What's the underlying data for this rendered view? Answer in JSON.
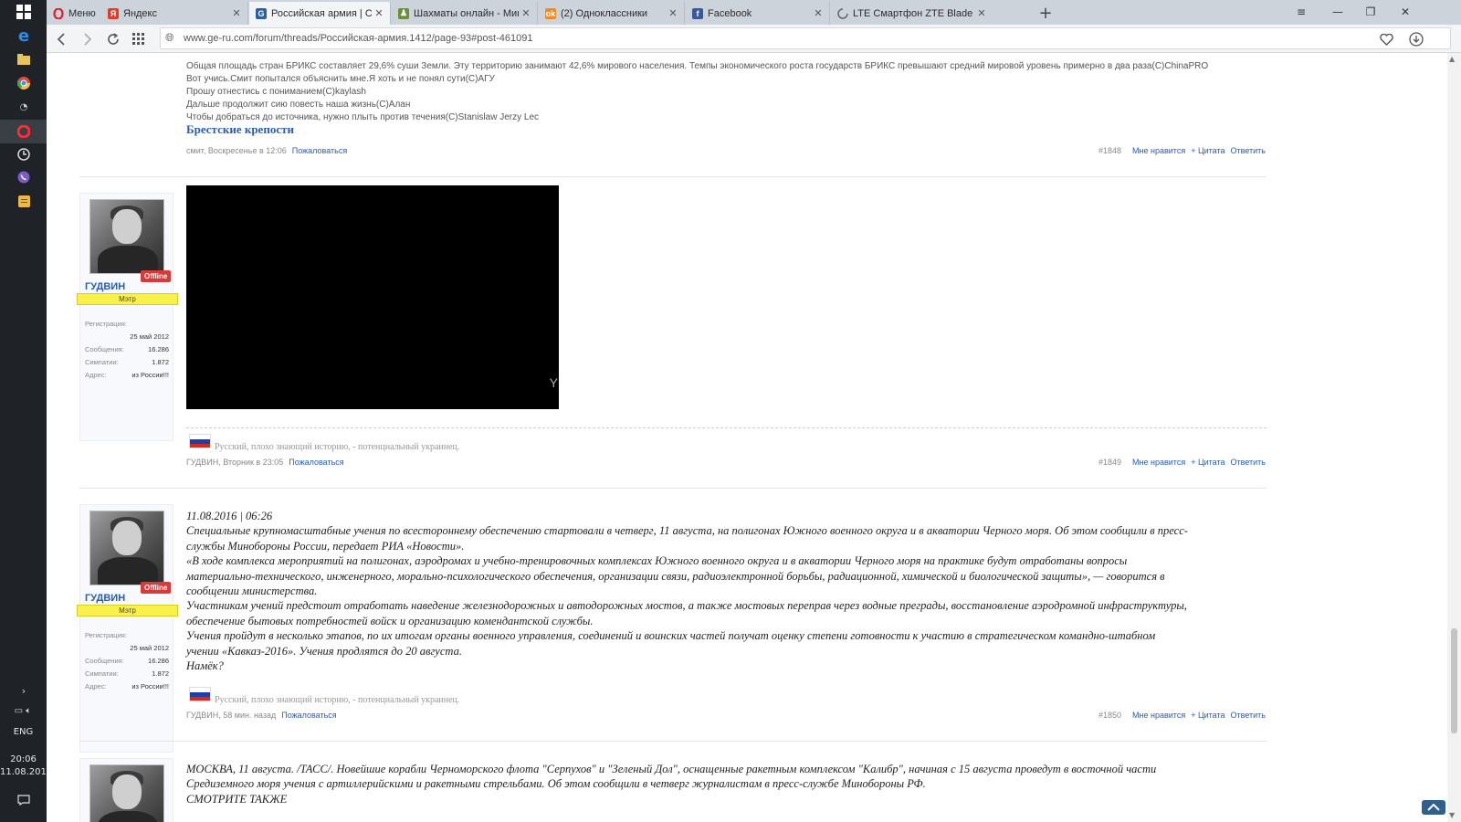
{
  "sidebar": {
    "icons": [
      "windows-start-icon",
      "edge-icon",
      "file-explorer-icon",
      "chrome-icon",
      "network-icon",
      "opera-icon",
      "clock-icon",
      "viber-icon",
      "notes-icon"
    ],
    "tray": {
      "language": "ENG",
      "time": "20:06",
      "date": "11.08.2016"
    }
  },
  "tabs": [
    {
      "label": "Меню"
    },
    {
      "label": "Яндекс"
    },
    {
      "label": "Российская армия | Стра"
    },
    {
      "label": "Шахматы онлайн - Мини"
    },
    {
      "label": "(2) Одноклассники"
    },
    {
      "label": "Facebook"
    },
    {
      "label": "LTE Смартфон ZTE Blade"
    }
  ],
  "address": {
    "url": "www.ge-ru.com/forum/threads/Российская-армия.1412/page-93#post-461091"
  },
  "top_signature": {
    "lines": [
      "Общая площадь стран БРИКС составляет 29,6% суши Земли. Эту территорию занимают 42,6% мирового населения. Темпы экономического роста государств БРИКС превышают средний мировой уровень примерно в два раза(С)ChinaPRO",
      "Вот учись.Смит попытался объяснить мне.Я хоть и не понял сути(С)АГУ",
      "Прошу отнестись с пониманием(С)kaylash",
      "Дальше продолжит сию повесть наша жизнь(С)Алан",
      "Чтобы добраться до источника, нужно плыть против течения(C)Stanislaw Jerzy Lec"
    ],
    "title": "Брестские крепости"
  },
  "posts": [
    {
      "meta_left": "смит, Воскресенье в 12:06",
      "report": "Пожаловаться",
      "number": "#1848",
      "like": "Мне нравится",
      "quote": "+ Цитата",
      "reply": "Ответить"
    },
    {
      "user": {
        "name": "ГУДВИН",
        "status": "Offline",
        "rank": "Мэтр",
        "reg_label": "Регистрация:",
        "reg_value": "25 май 2012",
        "msgs_label": "Сообщения:",
        "msgs_value": "16.286",
        "likes_label": "Симпатии:",
        "likes_value": "1.872",
        "addr_label": "Адрес:",
        "addr_value": "из России!!!"
      },
      "video_mark": "Y",
      "signature": "Русский, плохо знающий историю, - потенциальный украинец.",
      "meta_left": "ГУДВИН, Вторник в 23:05",
      "report": "Пожаловаться",
      "number": "#1849",
      "like": "Мне нравится",
      "quote": "+ Цитата",
      "reply": "Ответить"
    },
    {
      "user": {
        "name": "ГУДВИН",
        "status": "Offline",
        "rank": "Мэтр",
        "reg_label": "Регистрация:",
        "reg_value": "25 май 2012",
        "msgs_label": "Сообщения:",
        "msgs_value": "16.286",
        "likes_label": "Симпатии:",
        "likes_value": "1.872",
        "addr_label": "Адрес:",
        "addr_value": "из России!!!"
      },
      "body": [
        "11.08.2016 | 06:26",
        "Специальные крупномасштабные учения по всестороннему обеспечению стартовали в четверг, 11 августа, на полигонах Южного военного округа и в акватории Черного моря. Об этом сообщили в пресс-службы Минобороны России, передает РИА «Новости».",
        "«В ходе комплекса мероприятий на полигонах, аэродромах и учебно-тренировочных комплексах Южного военного округа и в акватории Черного моря на практике будут отработаны вопросы материально-технического, инженерного, морально-психологического обеспечения, организации связи, радиоэлектронной борьбы, радиационной, химической и биологической защиты», — говорится в сообщении министерства.",
        "Участникам учений предстоит отработать наведение железнодорожных и автодорожных мостов, а также мостовых переправ через водные преграды, восстановление аэродромной инфраструктуры, обеспечение бытовых потребностей войск и организацию комендантской службы.",
        "Учения пройдут в несколько этапов, по их итогам органы военного управления, соединений и воинских частей получат оценку степени готовности к участию в стратегическом командно-штабном учении «Кавказ-2016». Учения продлятся до 20 августа.",
        "Намёк?"
      ],
      "signature": "Русский, плохо знающий историю, - потенциальный украинец.",
      "meta_left": "ГУДВИН, 58 мин. назад",
      "report": "Пожаловаться",
      "number": "#1850",
      "like": "Мне нравится",
      "quote": "+ Цитата",
      "reply": "Ответить"
    },
    {
      "body": [
        "МОСКВА, 11 августа. /ТАСС/. Новейшие корабли Черноморского флота \"Серпухов\" и \"Зеленый Дол\", оснащенные ракетным комплексом \"Калибр\", начиная с 15 августа проведут в восточной части Средиземного моря учения с артиллерийскими и ракетными стрельбами. Об этом сообщили в четверг журналистам в пресс-службе Минобороны РФ.",
        "СМОТРИТЕ ТАКЖЕ"
      ]
    }
  ],
  "colors": {
    "link": "#2a5db0",
    "offline_badge": "#d63b3b",
    "rank_bar": "#f8f14b",
    "sidebar": "#1f2328",
    "tabbar": "#cdd3db"
  }
}
